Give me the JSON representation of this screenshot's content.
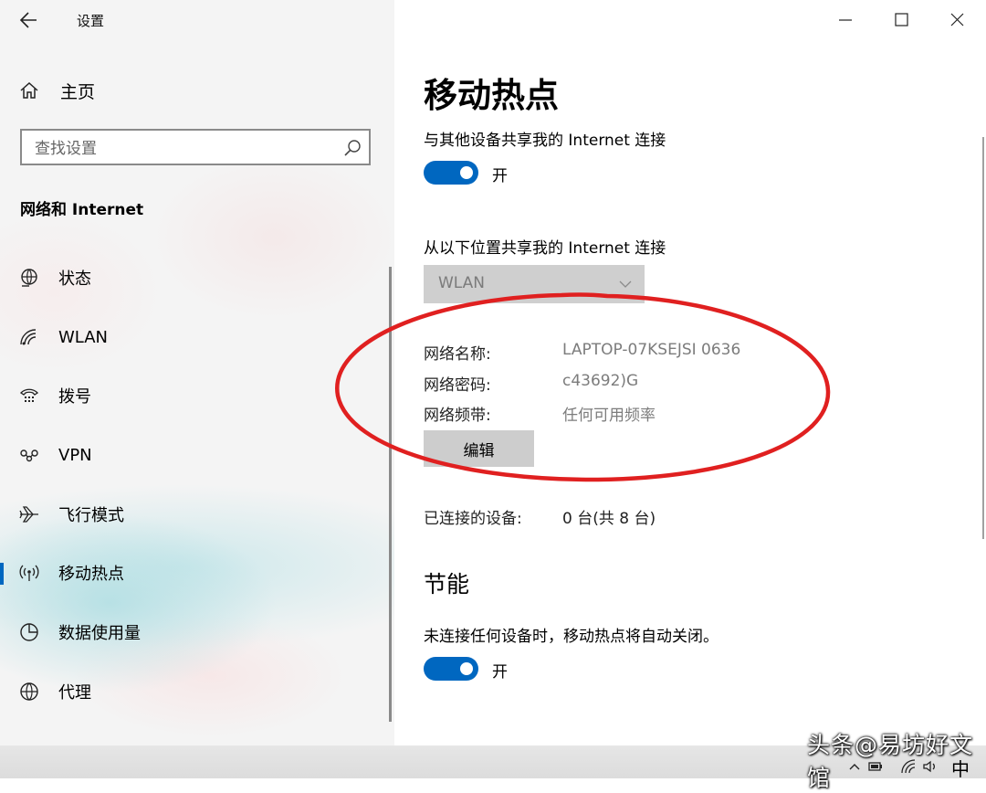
{
  "app": {
    "title": "设置"
  },
  "sidebar": {
    "home_label": "主页",
    "search_placeholder": "查找设置",
    "section_title": "网络和 Internet",
    "items": [
      {
        "label": "状态",
        "icon": "globe-status-icon"
      },
      {
        "label": "WLAN",
        "icon": "wifi-icon"
      },
      {
        "label": "拨号",
        "icon": "dialup-icon"
      },
      {
        "label": "VPN",
        "icon": "vpn-icon"
      },
      {
        "label": "飞行模式",
        "icon": "airplane-icon"
      },
      {
        "label": "移动热点",
        "icon": "hotspot-icon",
        "active": true
      },
      {
        "label": "数据使用量",
        "icon": "pie-chart-icon"
      },
      {
        "label": "代理",
        "icon": "globe-icon"
      }
    ]
  },
  "main": {
    "title": "移动热点",
    "share_label": "与其他设备共享我的 Internet 连接",
    "share_toggle": {
      "state": "开",
      "on": true
    },
    "from_label": "从以下位置共享我的 Internet 连接",
    "from_select": {
      "value": "WLAN"
    },
    "network": {
      "name_key": "网络名称:",
      "name_value": "LAPTOP-07KSEJSI 0636",
      "password_key": "网络密码:",
      "password_value": "c43692)G",
      "band_key": "网络频带:",
      "band_value": "任何可用频率"
    },
    "edit_button": "编辑",
    "connected_key": "已连接的设备:",
    "connected_value": "0 台(共 8 台)",
    "power_section": "节能",
    "power_label": "未连接任何设备时，移动热点将自动关闭。",
    "power_toggle": {
      "state": "开",
      "on": true
    }
  },
  "watermark": "头条@易坊好文馆",
  "taskbar": {
    "ime": "中"
  },
  "colors": {
    "accent": "#0067c0",
    "annotation": "#e02020"
  }
}
